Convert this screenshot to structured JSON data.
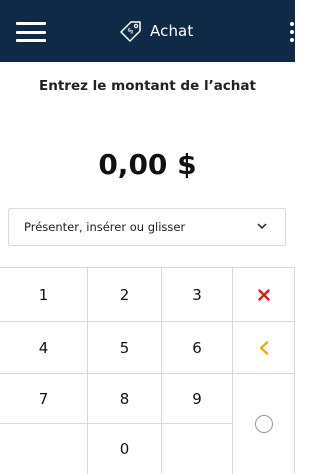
{
  "header": {
    "menu_icon": "hamburger-menu-icon",
    "title_icon": "price-tag-icon",
    "title": "Achat",
    "overflow_icon": "kebab-menu-icon",
    "background_color": "#0e2a47"
  },
  "prompt": "Entrez le montant de l’achat",
  "amount": "0,00 $",
  "card_entry": {
    "selected": "Présenter, insérer ou glisser",
    "icon": "chevron-down-icon"
  },
  "keypad": {
    "keys": [
      "1",
      "2",
      "3",
      "4",
      "5",
      "6",
      "7",
      "8",
      "9",
      "0"
    ],
    "clear_icon": "close-icon",
    "clear_color": "#d0221c",
    "backspace_icon": "chevron-left-icon",
    "backspace_color": "#f2a90c",
    "enter_icon": "circle-icon"
  }
}
